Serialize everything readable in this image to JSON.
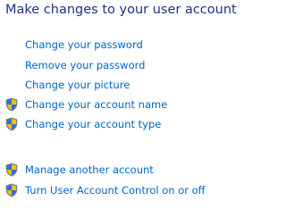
{
  "page_title": "Make changes to your user account",
  "links": [
    {
      "label": "Change your password",
      "shield": false
    },
    {
      "label": "Remove your password",
      "shield": false
    },
    {
      "label": "Change your picture",
      "shield": false
    },
    {
      "label": "Change your account name",
      "shield": true
    },
    {
      "label": "Change your account type",
      "shield": true
    },
    {
      "label": "Manage another account",
      "shield": true
    },
    {
      "label": "Turn User Account Control on or off",
      "shield": true
    }
  ],
  "colors": {
    "title": "#1e3287",
    "link": "#0066cc",
    "shield_icon": "uac-shield-icon"
  }
}
